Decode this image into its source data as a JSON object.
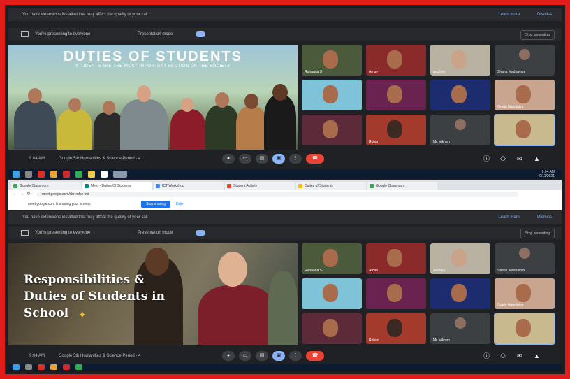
{
  "top_panel": {
    "warning": {
      "message": "You have extensions installed that may affect the quality of your call",
      "learn_more": "Learn more",
      "dismiss": "Dismiss"
    },
    "presenting": {
      "text": "You're presenting to everyone",
      "mode": "Presentation mode",
      "stop": "Stop presenting"
    },
    "slide": {
      "title": "DUTIES OF STUDENTS",
      "subtitle": "STUDENTS ARE THE MOST IMPORTANT SECTION OF THE SOCIETY"
    },
    "controls": {
      "time": "9:04 AM",
      "meeting": "Google 5th Humanities & Science Period - 4"
    }
  },
  "bottom_panel": {
    "warning": {
      "message": "You have extensions installed that may affect the quality of your call",
      "learn_more": "Learn more",
      "dismiss": "Dismiss"
    },
    "presenting": {
      "text": "You're presenting to everyone",
      "mode": "Presentation mode",
      "stop": "Stop presenting"
    },
    "slide": {
      "title": "Responsibilities &\nDuties of Students in\nSchool"
    },
    "controls": {
      "time": "9:04 AM",
      "meeting": "Google 5th Humanities & Science Period - 4"
    }
  },
  "participants": [
    {
      "name": "Ruhaana S"
    },
    {
      "name": "Arnav"
    },
    {
      "name": "Aadhya"
    },
    {
      "name": "Shanu Madhavan"
    },
    {
      "name": ""
    },
    {
      "name": ""
    },
    {
      "name": ""
    },
    {
      "name": "Geeta Nandiniya"
    },
    {
      "name": ""
    },
    {
      "name": "Rohan"
    },
    {
      "name": "Mr. Vikram"
    },
    {
      "name": ""
    }
  ],
  "browser": {
    "tabs": [
      "Google Classroom",
      "Meet - Duties Of Students",
      "ICT Workshop",
      "Student Activity",
      "Duties of Students",
      "Google Classroom"
    ],
    "url": "meet.google.com/xbr-ndcz-fmi",
    "share_message": "meet.google.com is sharing your screen.",
    "stop_sharing": "Stop sharing",
    "hide": "Hide"
  },
  "taskbar": {
    "time": "9:04 AM",
    "date": "9/11/2021"
  },
  "colors": {
    "frame": "#e21b1b",
    "meet_bg": "#202124",
    "end_call": "#ea4335",
    "accent": "#8ab4f8"
  }
}
